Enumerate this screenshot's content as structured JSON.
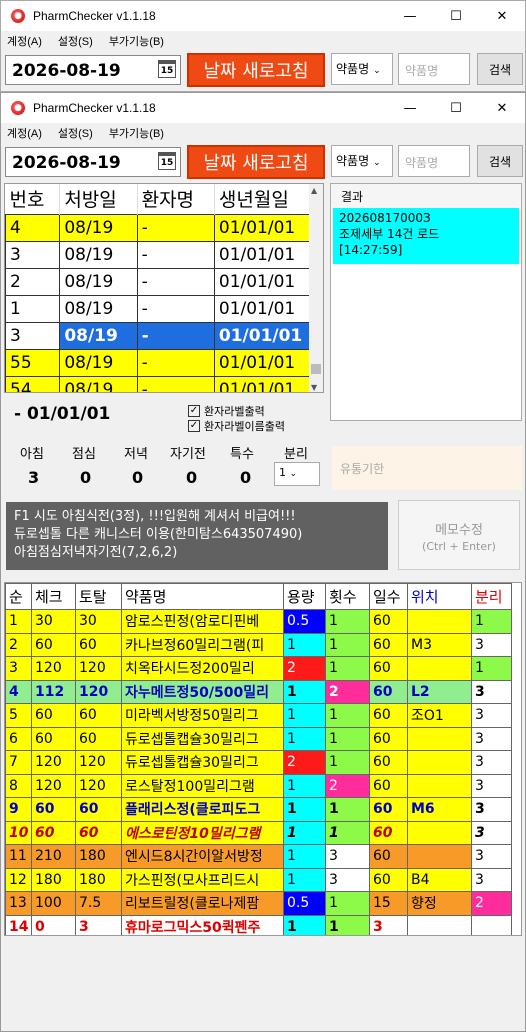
{
  "app": {
    "title": "PharmChecker v1.1.18",
    "menu": [
      "계정(A)",
      "설정(S)",
      "부가기능(B)"
    ]
  },
  "window_buttons": [
    "—",
    "☐",
    "✕"
  ],
  "toolbar": {
    "date": "2026-08-19",
    "calendar_day": "15",
    "refresh_label": "날짜 새로고침",
    "search_type": "약품명",
    "drug_placeholder": "약품명",
    "search_label": "검색"
  },
  "patients": {
    "headers": [
      "번호",
      "처방일",
      "환자명",
      "생년월일"
    ],
    "rows": [
      [
        "4",
        "08/19",
        "-",
        "01/01/01"
      ],
      [
        "3",
        "08/19",
        "-",
        "01/01/01"
      ],
      [
        "2",
        "08/19",
        "-",
        "01/01/01"
      ],
      [
        "1",
        "08/19",
        "-",
        "01/01/01"
      ],
      [
        "3",
        "08/19",
        "-",
        "01/01/01"
      ],
      [
        "55",
        "08/19",
        "-",
        "01/01/01"
      ],
      [
        "54",
        "08/19",
        "-",
        "01/01/01"
      ]
    ]
  },
  "result": {
    "header": "결과",
    "line1": "20260817000З",
    "line2": "조제세부 14건 로드",
    "line3": "[14:27:59]"
  },
  "selected_patient": "- 01/01/01",
  "options": {
    "label_print": "환자라벨출력",
    "name_label_print": "환자라벨이름출력"
  },
  "doses": {
    "labels": [
      "아침",
      "점심",
      "저녁",
      "자기전",
      "특수",
      "분리"
    ],
    "values": [
      "3",
      "0",
      "0",
      "0",
      "0"
    ],
    "split": "1"
  },
  "expiry_placeholder": "유통기한",
  "memo": {
    "line1": "F1 시도 아침식전(3정), !!!입원해 계셔서 비급여!!!",
    "line2": "듀로셉톨 다른 캐니스터 이용(한미탐스643507490)",
    "line3": "아침점심저녁자기전(7,2,6,2)"
  },
  "memo_button": {
    "label": "메모수정",
    "shortcut": "(Ctrl + Enter)"
  },
  "drugs": {
    "headers": [
      "순",
      "체크",
      "토탈",
      "약품명",
      "용량",
      "횟수",
      "일수",
      "위치",
      "분리"
    ],
    "rows": [
      [
        "1",
        "30",
        "30",
        "암로스핀정(암로디핀베",
        "0.5",
        "1",
        "60",
        "",
        "1"
      ],
      [
        "2",
        "60",
        "60",
        "카나브정60밀리그램(피",
        "1",
        "1",
        "60",
        "M3",
        "3"
      ],
      [
        "3",
        "120",
        "120",
        "치옥타시드정200밀리",
        "2",
        "1",
        "60",
        "",
        "1"
      ],
      [
        "4",
        "112",
        "120",
        "자누메트정50/500밀리",
        "1",
        "2",
        "60",
        "L2",
        "3"
      ],
      [
        "5",
        "60",
        "60",
        "미라벡서방정50밀리그",
        "1",
        "1",
        "60",
        "조O1",
        "3"
      ],
      [
        "6",
        "60",
        "60",
        "듀로셉톨캡슐30밀리그",
        "1",
        "1",
        "60",
        "",
        "3"
      ],
      [
        "7",
        "120",
        "120",
        "듀로셉톨캡슐30밀리그",
        "2",
        "1",
        "60",
        "",
        "3"
      ],
      [
        "8",
        "120",
        "120",
        "로스탈정100밀리그램",
        "1",
        "2",
        "60",
        "",
        "3"
      ],
      [
        "9",
        "60",
        "60",
        "플래리스정(클로피도그",
        "1",
        "1",
        "60",
        "M6",
        "3"
      ],
      [
        "10",
        "60",
        "60",
        "에스로틴정10밀리그램",
        "1",
        "1",
        "60",
        "",
        "3"
      ],
      [
        "11",
        "210",
        "180",
        "엔시드8시간이알서방정",
        "1",
        "3",
        "60",
        "",
        "3"
      ],
      [
        "12",
        "180",
        "180",
        "가스핀정(모사프리드시",
        "1",
        "3",
        "60",
        "B4",
        "3"
      ],
      [
        "13",
        "100",
        "7.5",
        "리보트릴정(클로나제팜",
        "0.5",
        "1",
        "15",
        "향정",
        "2"
      ],
      [
        "14",
        "0",
        "3",
        "휴마로그믹스50퀵펜주",
        "1",
        "1",
        "3",
        "",
        ""
      ]
    ]
  }
}
